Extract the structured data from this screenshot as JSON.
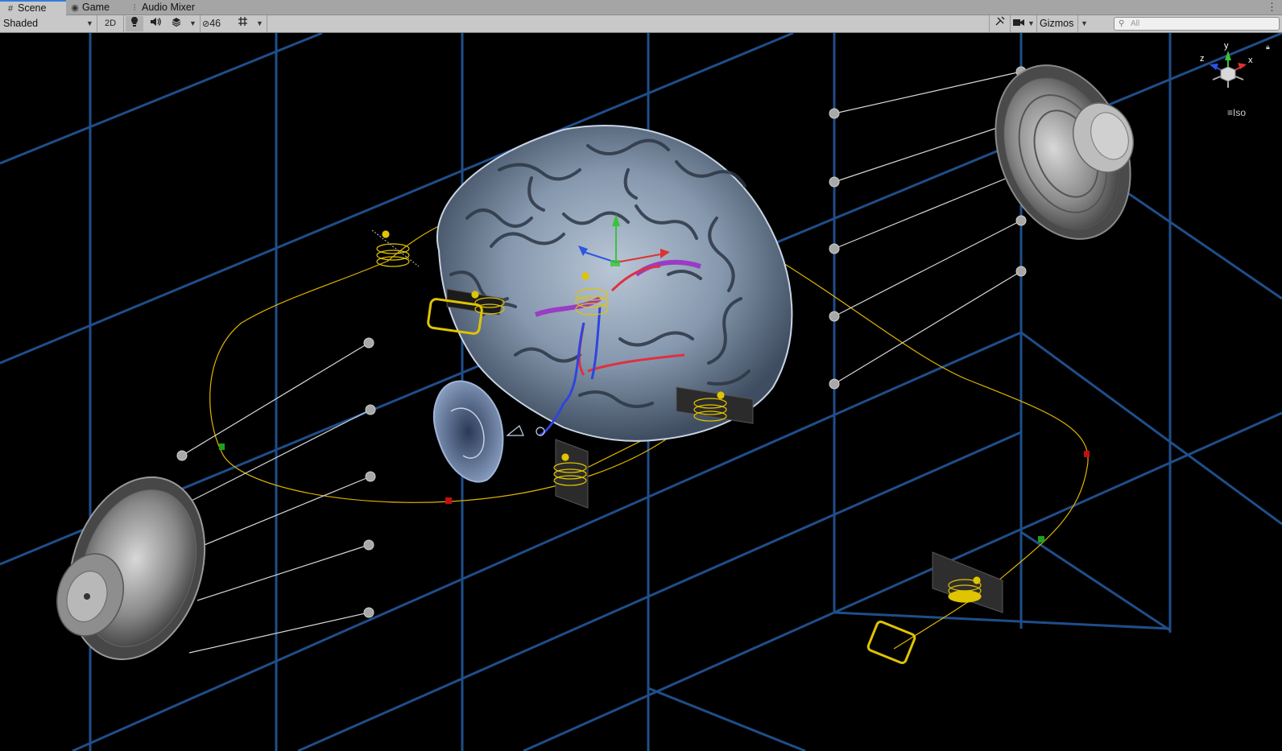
{
  "tabs": [
    {
      "label": "Scene",
      "icon": "hash-icon",
      "active": true
    },
    {
      "label": "Game",
      "icon": "gamepad-icon",
      "active": false
    },
    {
      "label": "Audio Mixer",
      "icon": "mixer-icon",
      "active": false
    }
  ],
  "toolbar": {
    "shading_mode": "Shaded",
    "mode_2d": "2D",
    "hidden_count": "46",
    "gizmos_label": "Gizmos",
    "search_placeholder": "All"
  },
  "scene_gizmo": {
    "axis_y": "y",
    "axis_x": "x",
    "axis_z": "z",
    "projection": "Iso"
  },
  "colors": {
    "grid": "#1f4e8a",
    "path": "#e0b400",
    "gizmo_y": "#39c439",
    "gizmo_x": "#d33",
    "gizmo_z": "#2a56e0"
  }
}
